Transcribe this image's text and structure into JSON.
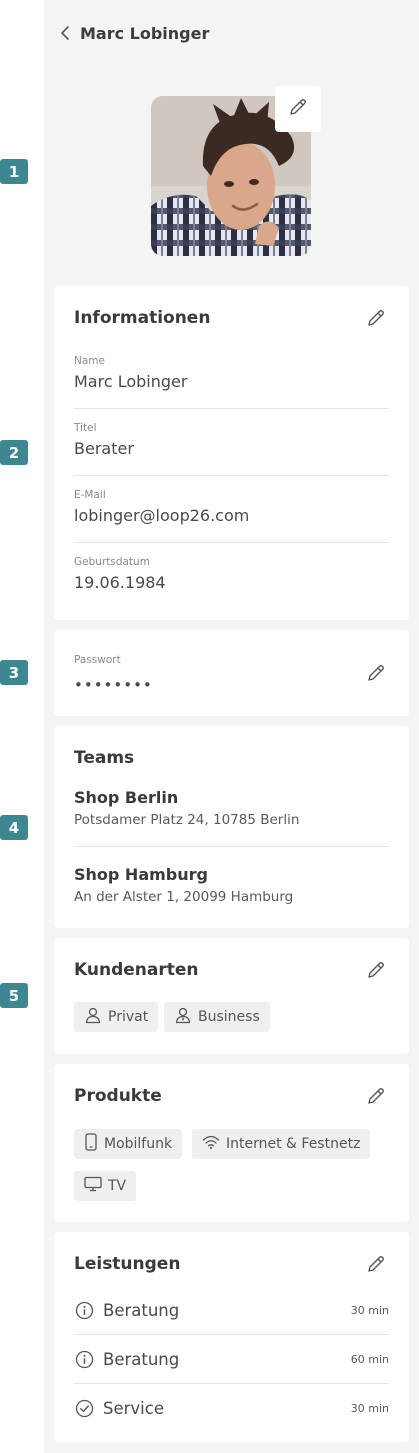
{
  "markers": [
    "1",
    "2",
    "3",
    "4",
    "5"
  ],
  "header": {
    "title": "Marc Lobinger"
  },
  "info": {
    "title": "Informationen",
    "fields": [
      {
        "label": "Name",
        "value": "Marc Lobinger"
      },
      {
        "label": "Titel",
        "value": "Berater"
      },
      {
        "label": "E-Mail",
        "value": "lobinger@loop26.com"
      },
      {
        "label": "Geburtsdatum",
        "value": "19.06.1984"
      }
    ]
  },
  "password": {
    "label": "Passwort",
    "value": "••••••••"
  },
  "teams": {
    "title": "Teams",
    "items": [
      {
        "name": "Shop Berlin",
        "address": "Potsdamer Platz 24, 10785 Berlin"
      },
      {
        "name": "Shop Hamburg",
        "address": "An der Alster 1, 20099 Hamburg"
      }
    ]
  },
  "kundenarten": {
    "title": "Kundenarten",
    "chips": [
      {
        "label": "Privat",
        "icon": "person-icon"
      },
      {
        "label": "Business",
        "icon": "business-person-icon"
      }
    ]
  },
  "produkte": {
    "title": "Produkte",
    "chips": [
      {
        "label": "Mobilfunk",
        "icon": "mobile-phone-icon"
      },
      {
        "label": "Internet & Festnetz",
        "icon": "wifi-icon"
      },
      {
        "label": "TV",
        "icon": "tv-icon"
      }
    ]
  },
  "leistungen": {
    "title": "Leistungen",
    "items": [
      {
        "label": "Beratung",
        "duration": "30 min",
        "icon": "info-icon"
      },
      {
        "label": "Beratung",
        "duration": "60 min",
        "icon": "info-icon"
      },
      {
        "label": "Service",
        "duration": "30 min",
        "icon": "check-circle-icon"
      }
    ]
  },
  "colors": {
    "marker": "#3d8791",
    "panel_bg": "#f3f4f3",
    "card_bg": "#ffffff",
    "chip_bg": "#efefef"
  }
}
